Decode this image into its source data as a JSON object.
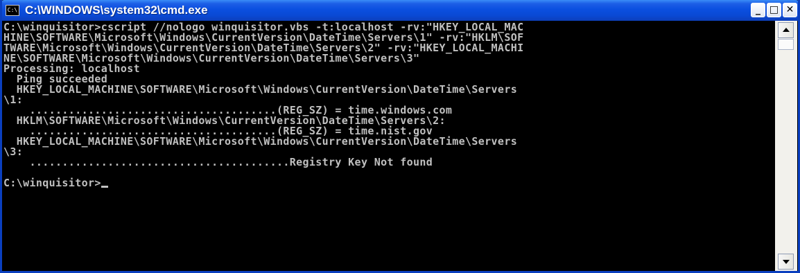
{
  "window": {
    "title": "C:\\WINDOWS\\system32\\cmd.exe",
    "icon_label": "C:\\",
    "minimize_label": "_",
    "maximize_label": "□",
    "close_label": "✕"
  },
  "console": {
    "lines": [
      "C:\\winquisitor>cscript //nologo winquisitor.vbs -t:localhost -rv:\"HKEY_LOCAL_MAC",
      "HINE\\SOFTWARE\\Microsoft\\Windows\\CurrentVersion\\DateTime\\Servers\\1\" -rv:\"HKLM\\SOF",
      "TWARE\\Microsoft\\Windows\\CurrentVersion\\DateTime\\Servers\\2\" -rv:\"HKEY_LOCAL_MACHI",
      "NE\\SOFTWARE\\Microsoft\\Windows\\CurrentVersion\\DateTime\\Servers\\3\"",
      "Processing: localhost",
      "  Ping succeeded",
      "  HKEY_LOCAL_MACHINE\\SOFTWARE\\Microsoft\\Windows\\CurrentVersion\\DateTime\\Servers",
      "\\1:",
      "    ......................................(REG_SZ) = time.windows.com",
      "  HKLM\\SOFTWARE\\Microsoft\\Windows\\CurrentVersion\\DateTime\\Servers\\2:",
      "    ......................................(REG_SZ) = time.nist.gov",
      "  HKEY_LOCAL_MACHINE\\SOFTWARE\\Microsoft\\Windows\\CurrentVersion\\DateTime\\Servers",
      "\\3:",
      "    ........................................Registry Key Not found",
      "",
      "C:\\winquisitor>"
    ]
  },
  "colors": {
    "title_bar": "#0a49d4",
    "console_background": "#000000",
    "console_text": "#c0c0c0"
  },
  "icons": [
    "cmd-window-icon",
    "minimize-icon",
    "maximize-icon",
    "close-icon",
    "scroll-up-arrow-icon",
    "scroll-down-arrow-icon"
  ]
}
